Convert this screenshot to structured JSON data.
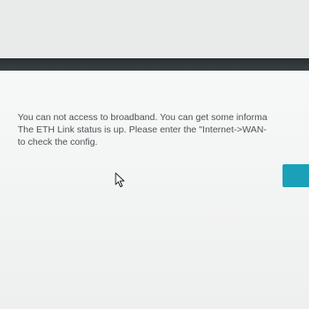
{
  "message": {
    "line1": "You can not access to broadband. You can get some informa",
    "line2": "The ETH Link status is up. Please enter the \"Internet->WAN-",
    "line3": "to check the config."
  },
  "button": {
    "label": ""
  },
  "colors": {
    "button": "#1aa0b8",
    "text": "#4d5356",
    "divider": "#2a2f33"
  },
  "icons": {
    "cursor": "mouse-pointer-icon"
  }
}
